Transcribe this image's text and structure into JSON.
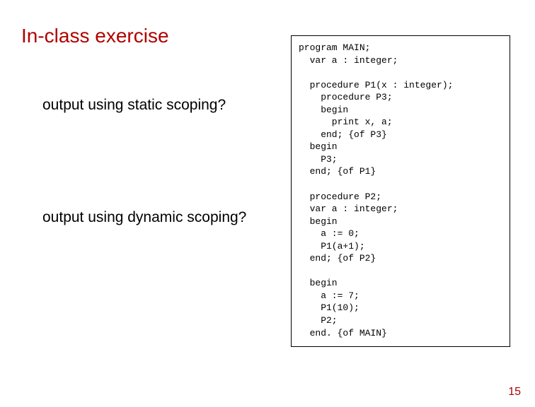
{
  "title": "In-class exercise",
  "question1": "output using static scoping?",
  "question2": "output using dynamic scoping?",
  "code": "program MAIN;\n  var a : integer;\n\n  procedure P1(x : integer);\n    procedure P3;\n    begin\n      print x, a;\n    end; {of P3}\n  begin\n    P3;\n  end; {of P1}\n\n  procedure P2;\n  var a : integer;\n  begin\n    a := 0;\n    P1(a+1);\n  end; {of P2}\n\n  begin\n    a := 7;\n    P1(10);\n    P2;\n  end. {of MAIN}",
  "pageNumber": "15"
}
